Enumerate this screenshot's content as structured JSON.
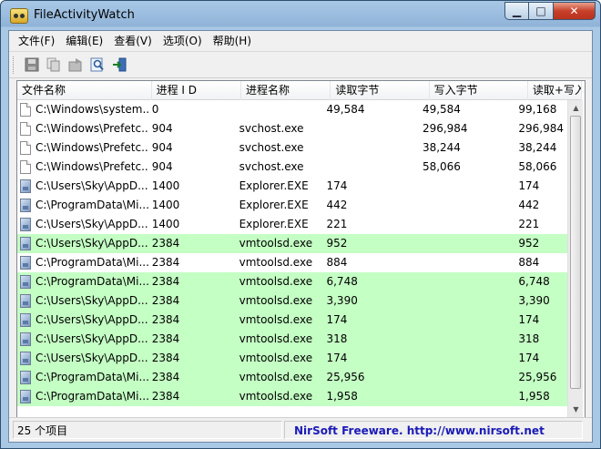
{
  "window": {
    "title": "FileActivityWatch",
    "buttons": {
      "minimize": "▁",
      "maximize": "□",
      "close": "✕"
    }
  },
  "menu": [
    "文件(F)",
    "编辑(E)",
    "查看(V)",
    "选项(O)",
    "帮助(H)"
  ],
  "toolbar": {
    "buttons": [
      "save-icon",
      "copy-icon",
      "properties-icon",
      "find-icon",
      "exit-icon"
    ]
  },
  "table": {
    "columns": [
      "文件名称",
      "进程 I D",
      "进程名称",
      "读取字节",
      "写入字节",
      "读取+写入字节"
    ],
    "rows": [
      {
        "file": "C:\\Windows\\system...",
        "pid": "0",
        "proc": "",
        "read": "49,584",
        "write": "49,584",
        "total": "99,168",
        "icon": "doc",
        "highlight": false
      },
      {
        "file": "C:\\Windows\\Prefetc...",
        "pid": "904",
        "proc": "svchost.exe",
        "read": "",
        "write": "296,984",
        "total": "296,984",
        "icon": "doc",
        "highlight": false
      },
      {
        "file": "C:\\Windows\\Prefetc...",
        "pid": "904",
        "proc": "svchost.exe",
        "read": "",
        "write": "38,244",
        "total": "38,244",
        "icon": "doc",
        "highlight": false
      },
      {
        "file": "C:\\Windows\\Prefetc...",
        "pid": "904",
        "proc": "svchost.exe",
        "read": "",
        "write": "58,066",
        "total": "58,066",
        "icon": "doc",
        "highlight": false
      },
      {
        "file": "C:\\Users\\Sky\\AppD...",
        "pid": "1400",
        "proc": "Explorer.EXE",
        "read": "174",
        "write": "",
        "total": "174",
        "icon": "img",
        "highlight": false
      },
      {
        "file": "C:\\ProgramData\\Mi...",
        "pid": "1400",
        "proc": "Explorer.EXE",
        "read": "442",
        "write": "",
        "total": "442",
        "icon": "img",
        "highlight": false
      },
      {
        "file": "C:\\Users\\Sky\\AppD...",
        "pid": "1400",
        "proc": "Explorer.EXE",
        "read": "221",
        "write": "",
        "total": "221",
        "icon": "img",
        "highlight": false
      },
      {
        "file": "C:\\Users\\Sky\\AppD...",
        "pid": "2384",
        "proc": "vmtoolsd.exe",
        "read": "952",
        "write": "",
        "total": "952",
        "icon": "img",
        "highlight": true
      },
      {
        "file": "C:\\ProgramData\\Mi...",
        "pid": "2384",
        "proc": "vmtoolsd.exe",
        "read": "884",
        "write": "",
        "total": "884",
        "icon": "img",
        "highlight": false
      },
      {
        "file": "C:\\ProgramData\\Mi...",
        "pid": "2384",
        "proc": "vmtoolsd.exe",
        "read": "6,748",
        "write": "",
        "total": "6,748",
        "icon": "img",
        "highlight": true
      },
      {
        "file": "C:\\Users\\Sky\\AppD...",
        "pid": "2384",
        "proc": "vmtoolsd.exe",
        "read": "3,390",
        "write": "",
        "total": "3,390",
        "icon": "img",
        "highlight": true
      },
      {
        "file": "C:\\Users\\Sky\\AppD...",
        "pid": "2384",
        "proc": "vmtoolsd.exe",
        "read": "174",
        "write": "",
        "total": "174",
        "icon": "img",
        "highlight": true
      },
      {
        "file": "C:\\Users\\Sky\\AppD...",
        "pid": "2384",
        "proc": "vmtoolsd.exe",
        "read": "318",
        "write": "",
        "total": "318",
        "icon": "img",
        "highlight": true
      },
      {
        "file": "C:\\Users\\Sky\\AppD...",
        "pid": "2384",
        "proc": "vmtoolsd.exe",
        "read": "174",
        "write": "",
        "total": "174",
        "icon": "img",
        "highlight": true
      },
      {
        "file": "C:\\ProgramData\\Mi...",
        "pid": "2384",
        "proc": "vmtoolsd.exe",
        "read": "25,956",
        "write": "",
        "total": "25,956",
        "icon": "img",
        "highlight": true
      },
      {
        "file": "C:\\ProgramData\\Mi...",
        "pid": "2384",
        "proc": "vmtoolsd.exe",
        "read": "1,958",
        "write": "",
        "total": "1,958",
        "icon": "img",
        "highlight": true
      }
    ]
  },
  "status": {
    "count": "25 个项目",
    "credit": "NirSoft Freeware.  http://www.nirsoft.net"
  },
  "colors": {
    "highlight_row": "#c4ffc4",
    "link": "#1a1ab8"
  }
}
